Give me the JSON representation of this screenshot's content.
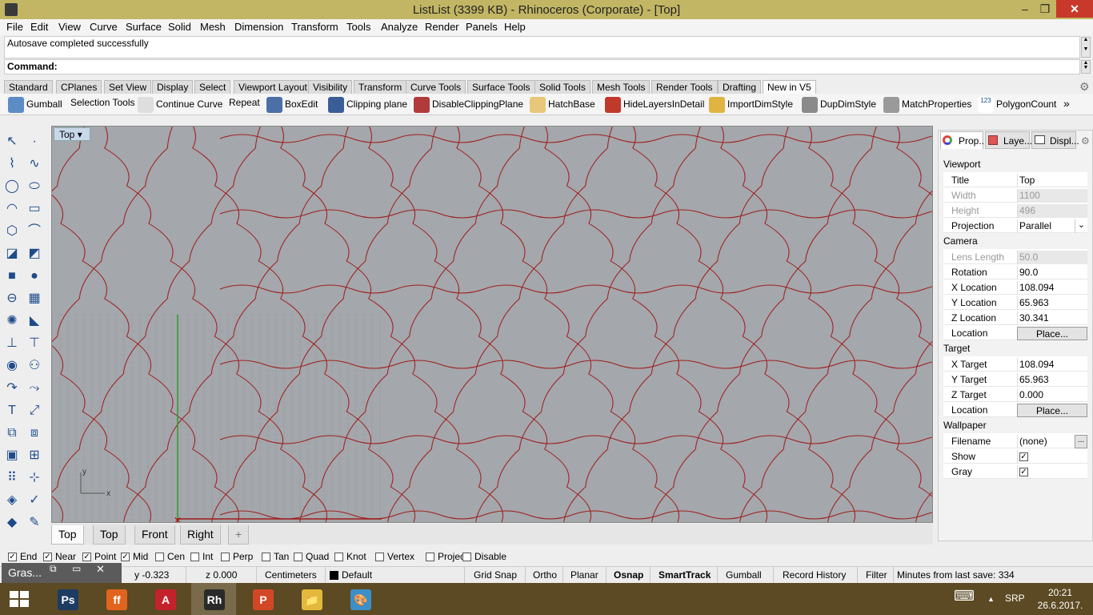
{
  "window": {
    "title": "ListList (3399 KB) - Rhinoceros (Corporate) - [Top]",
    "minimize": "–",
    "maximize": "❐",
    "close": "✕"
  },
  "menu": [
    "File",
    "Edit",
    "View",
    "Curve",
    "Surface",
    "Solid",
    "Mesh",
    "Dimension",
    "Transform",
    "Tools",
    "Analyze",
    "Render",
    "Panels",
    "Help"
  ],
  "history": {
    "text": "Autosave completed successfully"
  },
  "command": {
    "label": "Command:"
  },
  "toolbar_tabs": [
    "Standard",
    "CPlanes",
    "Set View",
    "Display",
    "Select",
    "Viewport Layout",
    "Visibility",
    "Transform",
    "Curve Tools",
    "Surface Tools",
    "Solid Tools",
    "Mesh Tools",
    "Render Tools",
    "Drafting",
    "New in V5"
  ],
  "toolbar_items": [
    "Gumball",
    "Selection Tools",
    "Continue Curve",
    "Repeat",
    "BoxEdit",
    "Clipping plane",
    "DisableClippingPlane",
    "HatchBase",
    "HideLayersInDetail",
    "ImportDimStyle",
    "DupDimStyle",
    "MatchProperties",
    "PolygonCount"
  ],
  "toolbar_more": "»",
  "polygoncount_badge": "123",
  "viewport": {
    "title": "Top",
    "dropdown": "▾",
    "axis_x": "x",
    "axis_y": "y"
  },
  "viewport_tabs": [
    "Top",
    "Top",
    "Front",
    "Right"
  ],
  "viewport_tab_add": "+",
  "panel": {
    "tabs": [
      "Prop...",
      "Laye...",
      "Displ..."
    ],
    "sections": [
      {
        "name": "Viewport",
        "rows": [
          {
            "k": "Title",
            "v": "Top"
          },
          {
            "k": "Width",
            "v": "1100",
            "dis": true
          },
          {
            "k": "Height",
            "v": "496",
            "dis": true
          },
          {
            "k": "Projection",
            "v": "Parallel",
            "select": true
          }
        ]
      },
      {
        "name": "Camera",
        "rows": [
          {
            "k": "Lens Length",
            "v": "50.0",
            "dis": true
          },
          {
            "k": "Rotation",
            "v": "90.0"
          },
          {
            "k": "X Location",
            "v": "108.094"
          },
          {
            "k": "Y Location",
            "v": "65.963"
          },
          {
            "k": "Z Location",
            "v": "30.341"
          },
          {
            "k": "Location",
            "v": "Place...",
            "btn": true
          }
        ]
      },
      {
        "name": "Target",
        "rows": [
          {
            "k": "X Target",
            "v": "108.094"
          },
          {
            "k": "Y Target",
            "v": "65.963"
          },
          {
            "k": "Z Target",
            "v": "0.000"
          },
          {
            "k": "Location",
            "v": "Place...",
            "btn": true
          }
        ]
      },
      {
        "name": "Wallpaper",
        "rows": [
          {
            "k": "Filename",
            "v": "(none)",
            "more": true
          },
          {
            "k": "Show",
            "check": true
          },
          {
            "k": "Gray",
            "check": true
          }
        ]
      }
    ],
    "checkmark": "✓",
    "select_arrow": "⌄",
    "more_button": "..."
  },
  "osnap": [
    {
      "label": "End",
      "on": true
    },
    {
      "label": "Near",
      "on": true
    },
    {
      "label": "Point",
      "on": true
    },
    {
      "label": "Mid",
      "on": true
    },
    {
      "label": "Cen",
      "on": false
    },
    {
      "label": "Int",
      "on": false
    },
    {
      "label": "Perp",
      "on": false
    },
    {
      "label": "Tan",
      "on": false
    },
    {
      "label": "Quad",
      "on": false
    },
    {
      "label": "Knot",
      "on": false
    },
    {
      "label": "Vertex",
      "on": false
    },
    {
      "label": "Project",
      "on": false
    },
    {
      "label": "Disable",
      "on": false
    }
  ],
  "status": {
    "y": "y -0.323",
    "z": "z 0.000",
    "units": "Centimeters",
    "layer": "Default",
    "grid_snap": "Grid Snap",
    "ortho": "Ortho",
    "planar": "Planar",
    "osnap": "Osnap",
    "smarttrack": "SmartTrack",
    "gumball": "Gumball",
    "record_history": "Record History",
    "filter": "Filter",
    "minutes": "Minutes from last save: 334"
  },
  "grasshopper_mini": {
    "label": "Gras...",
    "restore": "⧉",
    "maximize": "▭",
    "close": "✕"
  },
  "taskbar": {
    "apps": [
      {
        "name": "Ps",
        "color": "#1d3b63"
      },
      {
        "name": "ff",
        "color": "#e0641e"
      },
      {
        "name": "A",
        "color": "#c4222a"
      },
      {
        "name": "Rh",
        "color": "#2a2a2a"
      },
      {
        "name": "P",
        "color": "#d24726"
      },
      {
        "name": "📁",
        "color": "#e3b93c"
      },
      {
        "name": "🎨",
        "color": "#3d8fc8"
      }
    ],
    "keyboard": "⌨",
    "lang": "SRP",
    "arrow": "▲",
    "time": "20:21",
    "date": "26.6.2017."
  },
  "colors": {
    "titlebar": "#c2b664",
    "viewport": "#a4a7ab",
    "curve": "#9e1b1b",
    "grid": "#9aa0a4",
    "yaxis": "#2c9a2c"
  }
}
